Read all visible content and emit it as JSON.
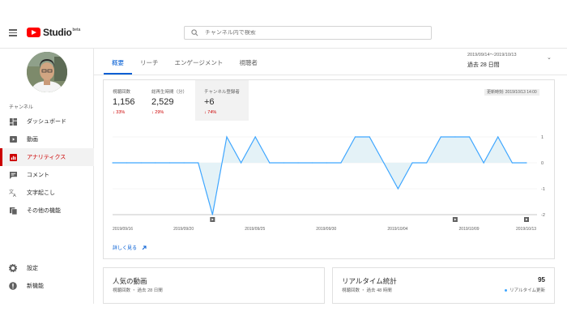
{
  "header": {
    "logo_text": "Studio",
    "logo_beta": "beta",
    "search_placeholder": "チャンネル内で検索"
  },
  "sidebar": {
    "channel_label": "チャンネル",
    "items": [
      {
        "label": "ダッシュボード",
        "icon": "dashboard-icon"
      },
      {
        "label": "動画",
        "icon": "video-icon"
      },
      {
        "label": "アナリティクス",
        "icon": "analytics-icon",
        "active": true
      },
      {
        "label": "コメント",
        "icon": "comment-icon"
      },
      {
        "label": "文字起こし",
        "icon": "translate-icon"
      },
      {
        "label": "その他の機能",
        "icon": "other-features-icon"
      }
    ],
    "bottom_items": [
      {
        "label": "設定",
        "icon": "settings-icon"
      },
      {
        "label": "新機能",
        "icon": "whats-new-icon"
      }
    ]
  },
  "tabs": [
    {
      "label": "概要",
      "active": true
    },
    {
      "label": "リーチ"
    },
    {
      "label": "エンゲージメント"
    },
    {
      "label": "視聴者"
    }
  ],
  "date_range": {
    "range": "2019/09/14〜2019/10/13",
    "period": "過去 28 日間"
  },
  "metrics": [
    {
      "label": "視聴回数",
      "value": "1,156",
      "change": "33%"
    },
    {
      "label": "総再生時間（分）",
      "value": "2,529",
      "change": "29%"
    },
    {
      "label": "チャンネル登録者",
      "value": "+6",
      "change": "74%",
      "selected": true
    }
  ],
  "update_badge": "更新時刻: 2019/10/13 14:00",
  "chart_data": {
    "type": "line",
    "x_tick_labels": [
      "2019/09/16",
      "2019/09/20",
      "2019/09/25",
      "2019/09/30",
      "2019/10/04",
      "2019/10/09",
      "2019/10/13"
    ],
    "y_tick_labels": [
      "1",
      "0",
      "-1",
      "-2"
    ],
    "ylim": [
      -2,
      1
    ],
    "values": [
      0,
      0,
      0,
      0,
      0,
      0,
      0,
      -2,
      1,
      0,
      1,
      0,
      0,
      0,
      0,
      0,
      0,
      1,
      1,
      0,
      -1,
      0,
      0,
      1,
      1,
      1,
      0,
      1,
      0,
      0
    ],
    "color": "#3ea6ff",
    "fill": "#e4f2f7",
    "markers_at": [
      7,
      24,
      29
    ],
    "grid": true
  },
  "more_link": "詳しく見る",
  "popular_card": {
    "title": "人気の動画",
    "sub": "視聴回数 ・ 過去 28 日間"
  },
  "realtime_card": {
    "title": "リアルタイム統計",
    "count": "95",
    "sub": "視聴回数 ・ 過去 48 時間",
    "update": "リアルタイム更新"
  }
}
